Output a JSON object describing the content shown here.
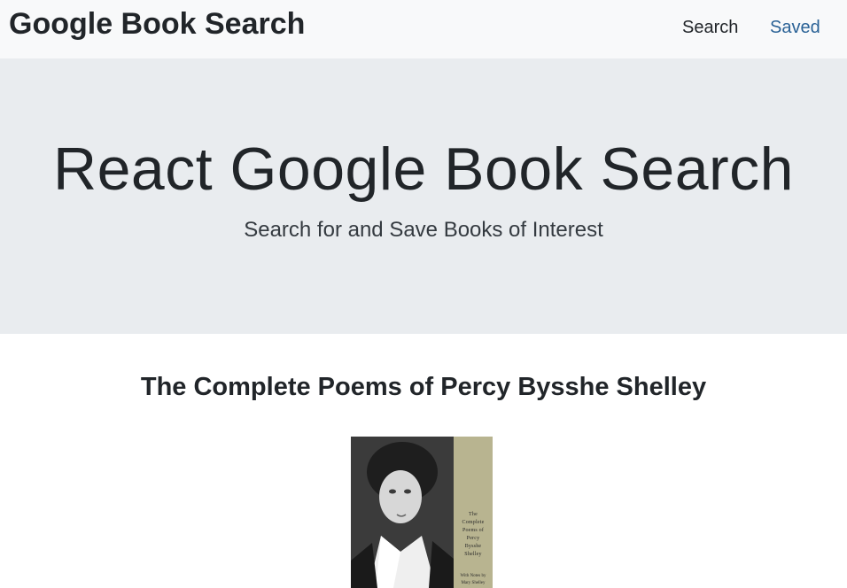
{
  "navbar": {
    "brand": "Google Book Search",
    "links": [
      {
        "label": "Search"
      },
      {
        "label": "Saved"
      }
    ]
  },
  "jumbotron": {
    "title": "React Google Book Search",
    "subtitle": "Search for and Save Books of Interest"
  },
  "results": [
    {
      "title": "The Complete Poems of Percy Bysshe Shelley",
      "cover_text": "The\nComplete\nPoems of\nPercy\nBysshe\nShelley",
      "cover_notes": "With Notes by\nMary Shelley"
    }
  ],
  "colors": {
    "navbar_bg": "#f8f9fa",
    "jumbotron_bg": "#e9ecef",
    "active_link": "#2a6296",
    "text": "#212529"
  }
}
